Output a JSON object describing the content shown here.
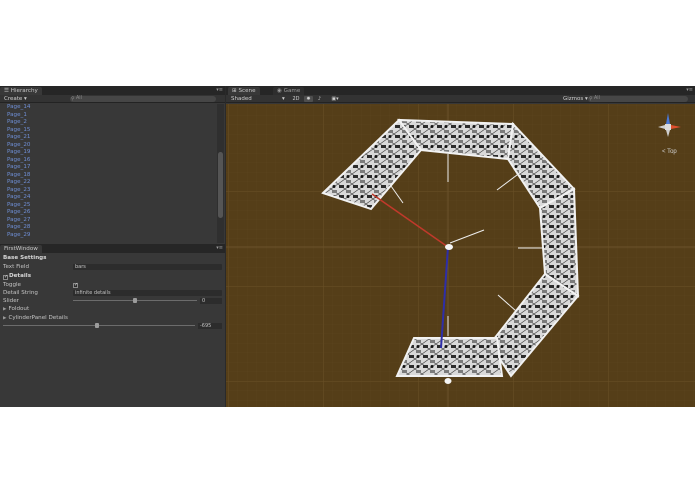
{
  "hierarchy": {
    "tab_label": "Hierarchy",
    "create_label": "Create",
    "search_placeholder": "All",
    "items": [
      "Page_14",
      "Page_1",
      "Page_2",
      "Page_15",
      "Page_21",
      "Page_20",
      "Page_19",
      "Page_16",
      "Page_17",
      "Page_18",
      "Page_22",
      "Page_23",
      "Page_24",
      "Page_25",
      "Page_26",
      "Page_27",
      "Page_28",
      "Page_29"
    ]
  },
  "first_window": {
    "tab_label": "FirstWindow",
    "base_settings": "Base Settings",
    "text_field_label": "Text Field",
    "text_field_value": "bars",
    "details_label": "Details",
    "toggle_label": "Toggle",
    "toggle_checked": true,
    "detail_string_label": "Detail String",
    "detail_string_value": "infinite details",
    "slider_label": "Slider",
    "slider_value": "0",
    "foldout_label": "Foldout",
    "cylinder_label": "CylinderPanel Details",
    "cylinder_value": "-695"
  },
  "scene": {
    "scene_tab": "Scene",
    "game_tab": "Game",
    "shading_mode": "Shaded",
    "mode_2d": "2D",
    "gizmos_label": "Gizmos",
    "search_placeholder": "All",
    "gizmo_view_label": "Top",
    "background_color": "#553e18",
    "grid_color": "#6a5127",
    "axis_x_color": "#c0392b",
    "axis_z_color": "#2e2ea8"
  }
}
